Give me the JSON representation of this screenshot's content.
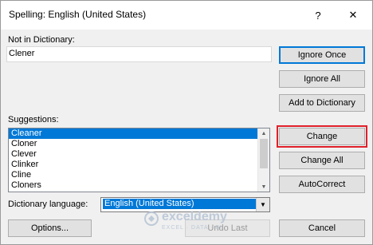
{
  "window": {
    "title": "Spelling: English (United States)",
    "help_label": "?",
    "close_label": "✕"
  },
  "not_in_dictionary": {
    "label": "Not in Dictionary:",
    "value": "Clener"
  },
  "suggestions": {
    "label": "Suggestions:",
    "items": [
      "Cleaner",
      "Cloner",
      "Clever",
      "Clinker",
      "Cline",
      "Cloners"
    ],
    "selected_index": 0
  },
  "dictionary_language": {
    "label": "Dictionary language:",
    "value": "English (United States)"
  },
  "buttons": {
    "ignore_once": "Ignore Once",
    "ignore_all": "Ignore All",
    "add_to_dictionary": "Add to Dictionary",
    "change": "Change",
    "change_all": "Change All",
    "autocorrect": "AutoCorrect",
    "options": "Options...",
    "undo_last": "Undo Last",
    "cancel": "Cancel"
  },
  "watermark": {
    "name": "exceldemy",
    "tagline": "EXCEL · DATA · BI"
  },
  "colors": {
    "selection": "#0078d7",
    "highlight_border": "#e0202a"
  }
}
